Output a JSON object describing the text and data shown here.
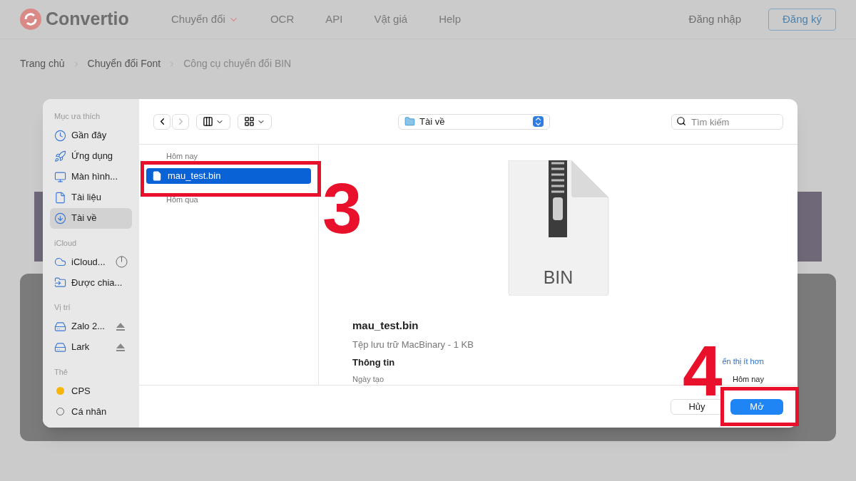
{
  "site": {
    "logo": "Convertio",
    "nav": [
      {
        "label": "Chuyển đổi",
        "dropdown": true
      },
      {
        "label": "OCR",
        "dropdown": false
      },
      {
        "label": "API",
        "dropdown": false
      },
      {
        "label": "Vật giá",
        "dropdown": false
      },
      {
        "label": "Help",
        "dropdown": false
      }
    ],
    "login": "Đăng nhập",
    "signup": "Đăng ký"
  },
  "breadcrumb": [
    {
      "label": "Trang chủ",
      "current": false
    },
    {
      "label": "Chuyển đổi Font",
      "current": false
    },
    {
      "label": "Công cụ chuyển đổi BIN",
      "current": true
    }
  ],
  "dialog": {
    "sidebar": [
      {
        "title": "Mục ưa thích",
        "items": [
          {
            "kind": "clock",
            "label": "Gần đây",
            "selected": false
          },
          {
            "kind": "apps",
            "label": "Ứng dụng",
            "selected": false
          },
          {
            "kind": "desktop",
            "label": "Màn hình...",
            "selected": false
          },
          {
            "kind": "document",
            "label": "Tài liệu",
            "selected": false
          },
          {
            "kind": "download",
            "label": "Tài về",
            "selected": true
          }
        ]
      },
      {
        "title": "iCloud",
        "items": [
          {
            "kind": "cloud",
            "label": "iCloud...",
            "selected": false,
            "progress": true
          },
          {
            "kind": "shared",
            "label": "Được chia...",
            "selected": false
          }
        ]
      },
      {
        "title": "Vị trí",
        "items": [
          {
            "kind": "drive",
            "label": "Zalo 2...",
            "selected": false,
            "eject": true
          },
          {
            "kind": "drive",
            "label": "Lark",
            "selected": false,
            "eject": true
          }
        ]
      },
      {
        "title": "Thẻ",
        "items": [
          {
            "kind": "tag",
            "label": "CPS",
            "selected": false,
            "color": "#f5b50a"
          },
          {
            "kind": "tag",
            "label": "Cá nhân",
            "selected": false
          }
        ]
      }
    ],
    "location": "Tài về",
    "search": {
      "placeholder": "Tìm kiếm"
    },
    "files": [
      {
        "group": "Hôm nay",
        "items": [
          {
            "name": "mau_test.bin",
            "selected": true
          }
        ]
      },
      {
        "group": "Hôm qua"
      }
    ],
    "preview": {
      "icon_label": "BIN",
      "name": "mau_test.bin",
      "subtitle": "Tệp lưu trữ MacBinary - 1 KB",
      "info_title": "Thông tin",
      "show_less": "ển thị ít hơn",
      "field": "Ngày tạo",
      "value": "Hôm nay"
    },
    "buttons": [
      {
        "label": "Hủy",
        "primary": false
      },
      {
        "label": "Mở",
        "primary": true
      }
    ]
  },
  "annotations": [
    {
      "label": "3"
    },
    {
      "label": "4"
    }
  ]
}
